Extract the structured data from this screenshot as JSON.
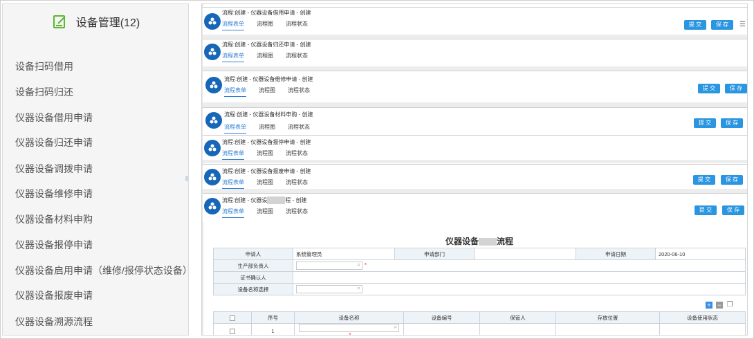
{
  "sidebar": {
    "title": "设备管理(12)",
    "items": [
      {
        "label": "设备扫码借用"
      },
      {
        "label": "设备扫码归还"
      },
      {
        "label": "仪器设备借用申请"
      },
      {
        "label": "仪器设备归还申请"
      },
      {
        "label": "仪器设备调拨申请"
      },
      {
        "label": "仪器设备维修申请"
      },
      {
        "label": "仪器设备材料申购"
      },
      {
        "label": "仪器设备报停申请"
      },
      {
        "label": "仪器设备启用申请（维修/报停状态设备）"
      },
      {
        "label": "仪器设备报废申请"
      },
      {
        "label": "仪器设备溯源流程"
      }
    ]
  },
  "tabs": {
    "form": "流程表单",
    "diagram": "流程图",
    "status": "流程状态"
  },
  "buttons": {
    "submit": "提 交",
    "save": "保 存"
  },
  "flows": [
    {
      "title": "流程:创建 - 仪器设备借用申请 - 创建"
    },
    {
      "title": "流程:创建 - 仪器设备归还申请 - 创建"
    },
    {
      "title": "流程:创建 - 仪器设备维修申请 - 创建"
    },
    {
      "title": "流程:创建 - 仪器设备材料申购 - 创建"
    },
    {
      "title": "流程:创建 - 仪器设备报停申请 - 创建"
    },
    {
      "title": "流程:创建 - 仪器设备报废申请 - 创建"
    },
    {
      "title_a": "流程:创建 - 仪器设",
      "title_b": "程 - 创建"
    }
  ],
  "form": {
    "title_a": "仪器设备",
    "title_b": "流程",
    "applicant_label": "申请人",
    "applicant_value": "系统管理员",
    "dept_label": "申请部门",
    "dept_value": "",
    "date_label": "申请日期",
    "date_value": "2020-06-10",
    "prod_leader_label": "生产部负责人",
    "cert_label": "证书确认人",
    "device_select_label": "设备名称选择",
    "table": {
      "headers": [
        "序号",
        "设备名称",
        "设备编号",
        "保管人",
        "存放位置",
        "设备使用状态"
      ],
      "rows": [
        {
          "no": "1"
        }
      ]
    }
  }
}
